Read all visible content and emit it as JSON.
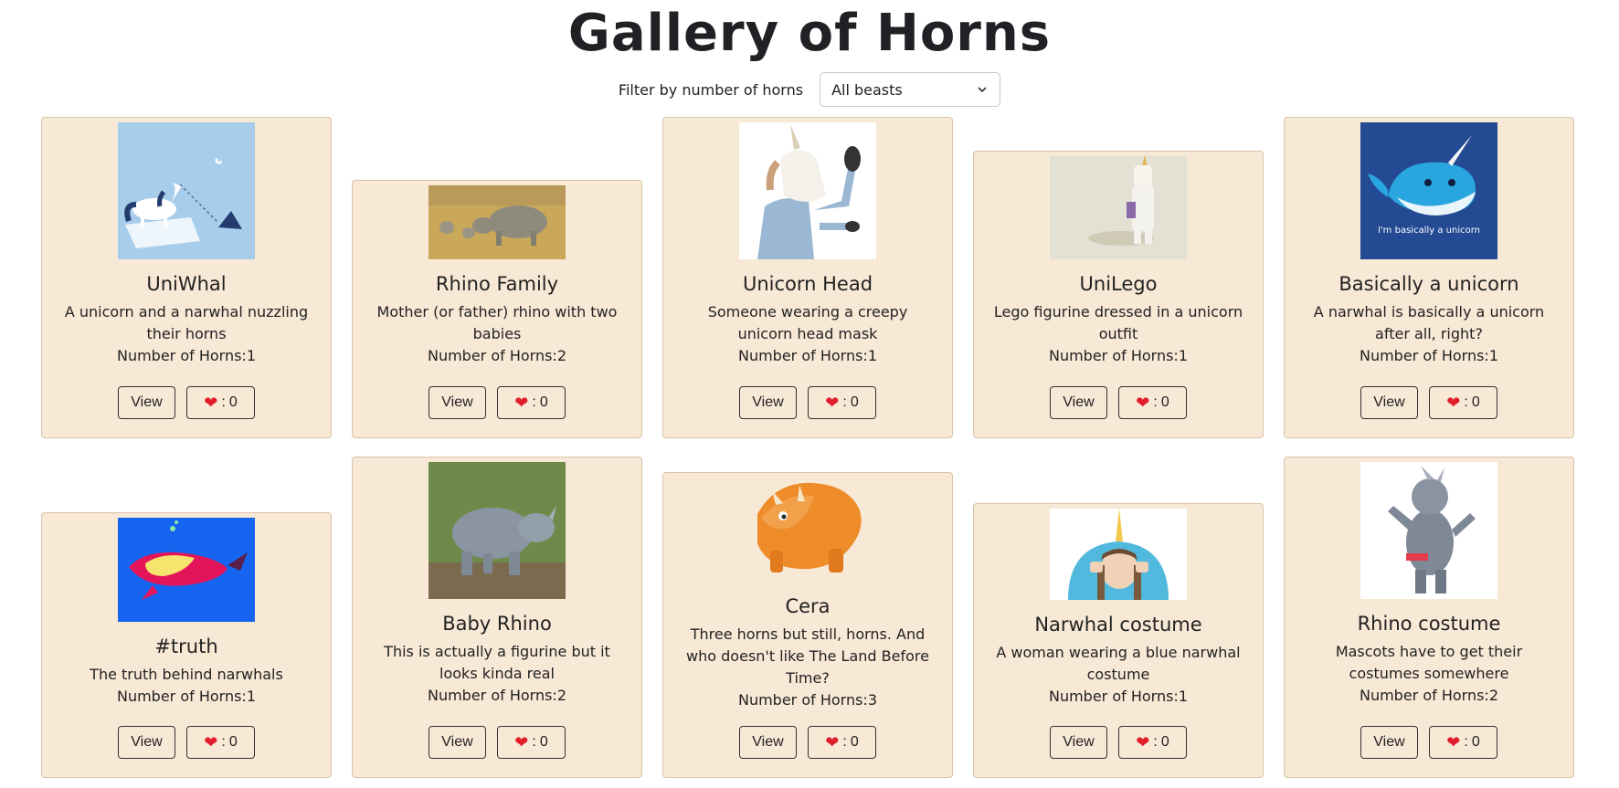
{
  "title": "Gallery of Horns",
  "filter": {
    "label": "Filter by number of horns",
    "selected": "All beasts"
  },
  "view_label": "View",
  "like_sep": ": ",
  "cards": [
    {
      "title": "UniWhal",
      "desc": "A unicorn and a narwhal nuzzling their horns",
      "horns_label": "Number of Horns:",
      "horns": 1,
      "likes": 0,
      "image": "unicorn-narwhal-cartoon"
    },
    {
      "title": "Rhino Family",
      "desc": "Mother (or father) rhino with two babies",
      "horns_label": "Number of Horns:",
      "horns": 2,
      "likes": 0,
      "image": "rhino-family-photo"
    },
    {
      "title": "Unicorn Head",
      "desc": "Someone wearing a creepy unicorn head mask",
      "horns_label": "Number of Horns:",
      "horns": 1,
      "likes": 0,
      "image": "unicorn-mask-photo"
    },
    {
      "title": "UniLego",
      "desc": "Lego figurine dressed in a unicorn outfit",
      "horns_label": "Number of Horns:",
      "horns": 1,
      "likes": 0,
      "image": "lego-unicorn-photo"
    },
    {
      "title": "Basically a unicorn",
      "desc": "A narwhal is basically a unicorn after all, right?",
      "horns_label": "Number of Horns:",
      "horns": 1,
      "likes": 0,
      "image": "narwhal-cartoon",
      "image_text": "I'm basically a unicorn"
    },
    {
      "title": "#truth",
      "desc": "The truth behind narwhals",
      "horns_label": "Number of Horns:",
      "horns": 1,
      "likes": 0,
      "image": "narwhal-truth-cartoon"
    },
    {
      "title": "Baby Rhino",
      "desc": "This is actually a figurine but it looks kinda real",
      "horns_label": "Number of Horns:",
      "horns": 2,
      "likes": 0,
      "image": "baby-rhino-photo"
    },
    {
      "title": "Cera",
      "desc": "Three horns but still, horns. And who doesn't like The Land Before Time?",
      "horns_label": "Number of Horns:",
      "horns": 3,
      "likes": 0,
      "image": "triceratops-cartoon"
    },
    {
      "title": "Narwhal costume",
      "desc": "A woman wearing a blue narwhal costume",
      "horns_label": "Number of Horns:",
      "horns": 1,
      "likes": 0,
      "image": "narwhal-costume-photo"
    },
    {
      "title": "Rhino costume",
      "desc": "Mascots have to get their costumes somewhere",
      "horns_label": "Number of Horns:",
      "horns": 2,
      "likes": 0,
      "image": "rhino-mascot-photo"
    }
  ],
  "icons": {
    "heart": "heart-icon",
    "chevron": "chevron-down-icon"
  },
  "colors": {
    "card_bg": "#f8e8d6",
    "heart": "#e11d2b",
    "title": "#1f2124"
  }
}
